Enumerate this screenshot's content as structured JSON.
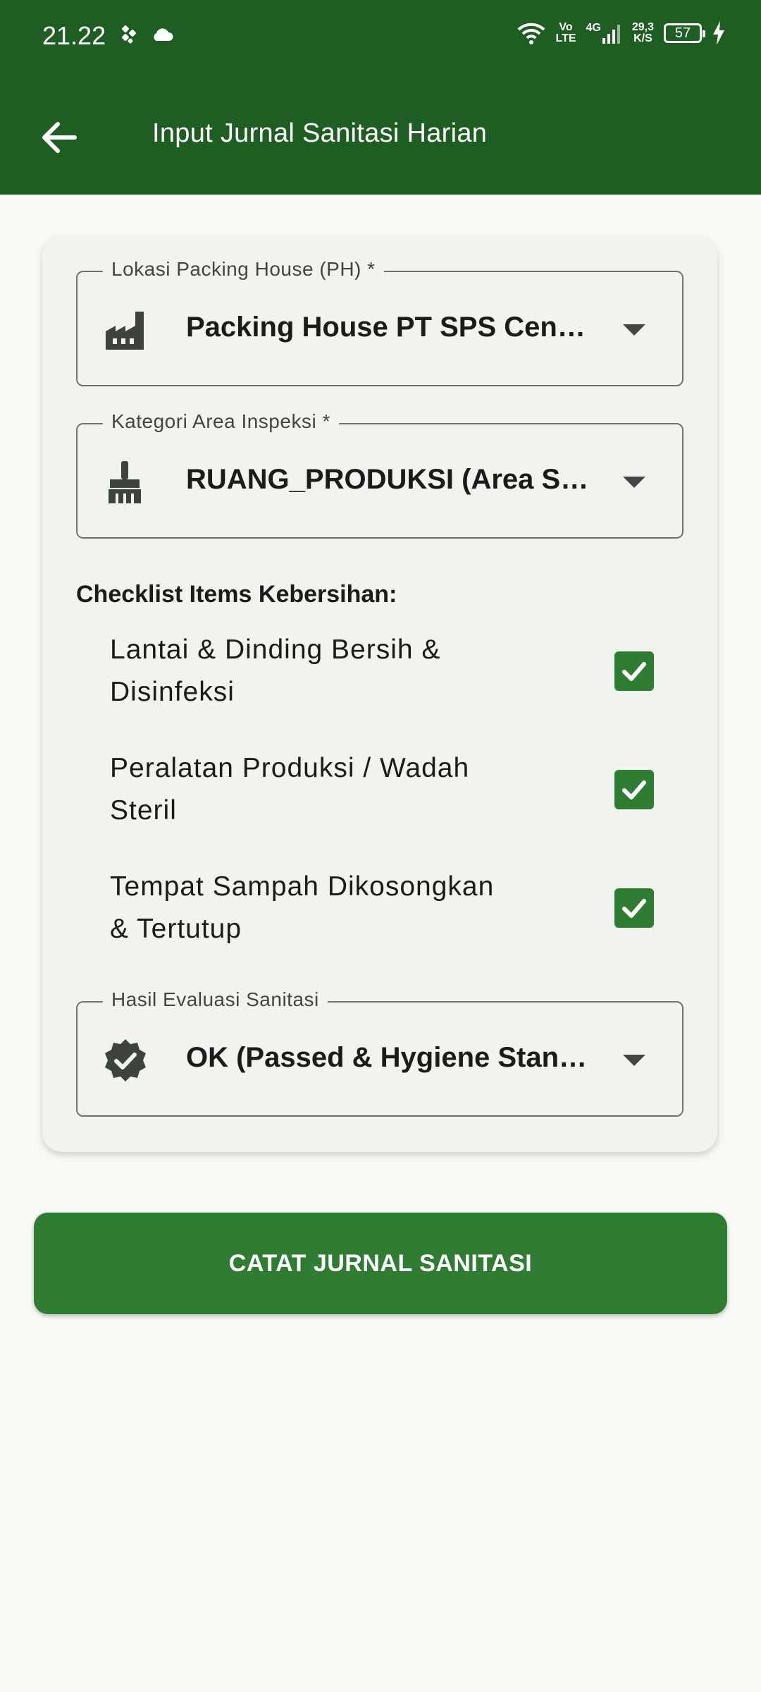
{
  "status_bar": {
    "time": "21.22",
    "left_icons": [
      "app-notification-icon",
      "cloud-icon"
    ],
    "volte_top": "Vo",
    "volte_bottom": "LTE",
    "network": "4G",
    "speed_value": "29,3",
    "speed_unit": "K/S",
    "battery_level": "57",
    "icons": [
      "wifi-icon",
      "signal-icon",
      "battery-icon",
      "charging-icon"
    ]
  },
  "app_bar": {
    "title": "Input Jurnal Sanitasi Harian",
    "back_icon": "arrow-left-icon"
  },
  "form": {
    "location": {
      "label": "Lokasi Packing House (PH) *",
      "value": "Packing House PT SPS Central",
      "icon": "factory-icon"
    },
    "area": {
      "label": "Kategori Area Inspeksi *",
      "value": "RUANG_PRODUKSI (Area Sortasi)",
      "icon": "broom-icon"
    },
    "checklist_title": "Checklist Items Kebersihan:",
    "checklist": [
      {
        "label": "Lantai & Dinding Bersih & Disinfeksi",
        "checked": true
      },
      {
        "label": "Peralatan Produksi / Wadah Steril",
        "checked": true
      },
      {
        "label": "Tempat Sampah Dikosongkan & Tertutup",
        "checked": true
      }
    ],
    "evaluation": {
      "label": "Hasil Evaluasi Sanitasi",
      "value": "OK (Passed & Hygiene Standard)",
      "icon": "verified-badge-icon"
    }
  },
  "submit_label": "CATAT JURNAL SANITASI",
  "colors": {
    "primary_dark": "#1e5e23",
    "primary": "#2e7d32",
    "card_bg": "#f1f4ec",
    "page_bg": "#f7f9f5"
  }
}
